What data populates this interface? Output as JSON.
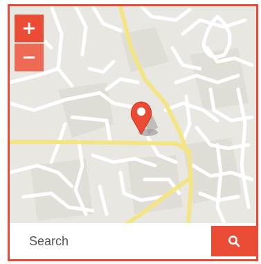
{
  "colors": {
    "accent": "#e94b35",
    "accent_light": "#ef6a55",
    "map_background": "#e9e7e2",
    "major_road": "#f3e585",
    "minor_road": "#ffffff"
  },
  "map": {
    "zoom_in_label": "+",
    "zoom_out_label": "−",
    "marker_icon": "map-pin-icon"
  },
  "search": {
    "placeholder": "Search",
    "value": "",
    "button_icon": "search-icon"
  }
}
